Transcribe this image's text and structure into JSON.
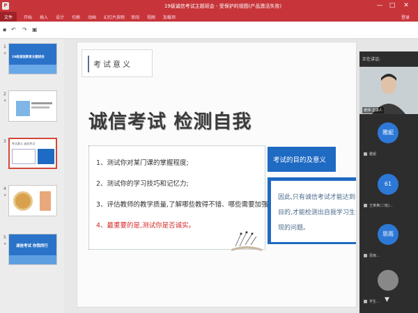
{
  "titlebar": {
    "logo": "P",
    "title": "19级诚信考试主题班会 - 受保护的视图(产品激活失败)",
    "minimize": "—",
    "maximize": "□",
    "close": "✕"
  },
  "ribbon": {
    "tabs": [
      "文件",
      "开始",
      "插入",
      "设计",
      "切换",
      "动画",
      "幻灯片放映",
      "审阅",
      "视图",
      "加载项"
    ],
    "login": "登录"
  },
  "qab": {
    "save": "▪",
    "undo": "↶",
    "redo": "↷",
    "start": "▣"
  },
  "thumbnails": [
    {
      "num": "1",
      "title": "19级诚信教育主题班会"
    },
    {
      "num": "2",
      "title": ""
    },
    {
      "num": "3",
      "title": "考试意义  诚信考试"
    },
    {
      "num": "4",
      "title": ""
    },
    {
      "num": "5",
      "title": "诚信考试 你我同行"
    }
  ],
  "slide": {
    "section_label": "考试意义",
    "title": "诚信考试  检测自我",
    "list": [
      "1、测试你对某门课的掌握程度;",
      "2、测试你的学习技巧和记忆力;",
      "3、评估教师的教学质量,了解哪些教得不错、哪些需要加强;",
      "4、最重要的是,测试你是否诚实。"
    ],
    "blue_label": "考试的目的及意义",
    "blue_text": [
      "因此,只有诚信考试才能达到考试",
      "目的,才能检测出自我学习生活",
      "现的问题。"
    ]
  },
  "video": {
    "header": "正在讲话:",
    "speaker": "老师-主讲人",
    "participants": [
      {
        "initials": "雅妮",
        "name": "雅妮"
      },
      {
        "initials": "61",
        "name": "王某某(二班)…"
      },
      {
        "initials": "思雨",
        "name": "思雨…"
      },
      {
        "initials": "",
        "name": "学生…"
      }
    ],
    "arrow": "▼"
  },
  "colors": {
    "titlebar": "#c7353a",
    "accent_blue": "#1f6ac2",
    "warning_red": "#d42a2a"
  }
}
